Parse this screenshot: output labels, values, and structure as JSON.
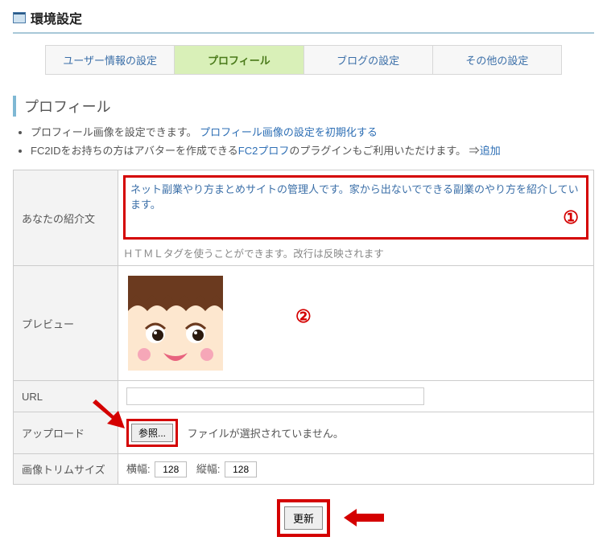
{
  "page_title": "環境設定",
  "tabs": [
    {
      "label": "ユーザー情報の設定",
      "active": false
    },
    {
      "label": "プロフィール",
      "active": true
    },
    {
      "label": "ブログの設定",
      "active": false
    },
    {
      "label": "その他の設定",
      "active": false
    }
  ],
  "section_title": "プロフィール",
  "bullets": {
    "b1_pre": "プロフィール画像を設定できます。",
    "b1_link": "プロフィール画像の設定を初期化する",
    "b2_pre": "FC2IDをお持ちの方はアバターを作成できる",
    "b2_link1": "FC2プロフ",
    "b2_mid": "のプラグインもご利用いただけます。",
    "b2_arrow": "⇒",
    "b2_link2": "追加"
  },
  "rows": {
    "intro_label": "あなたの紹介文",
    "intro_value": "ネット副業やり方まとめサイトの管理人です。家から出ないでできる副業のやり方を紹介しています。",
    "intro_note": "ＨＴＭＬタグを使うことができます。改行は反映されます",
    "preview_label": "プレビュー",
    "url_label": "URL",
    "url_value": "",
    "upload_label": "アップロード",
    "browse_label": "参照...",
    "upload_note": "ファイルが選択されていません。",
    "trim_label": "画像トリムサイズ",
    "trim_w_label": "横幅:",
    "trim_w_value": "128",
    "trim_h_label": "縦幅:",
    "trim_h_value": "128"
  },
  "badges": {
    "one": "①",
    "two": "②"
  },
  "submit_label": "更新"
}
